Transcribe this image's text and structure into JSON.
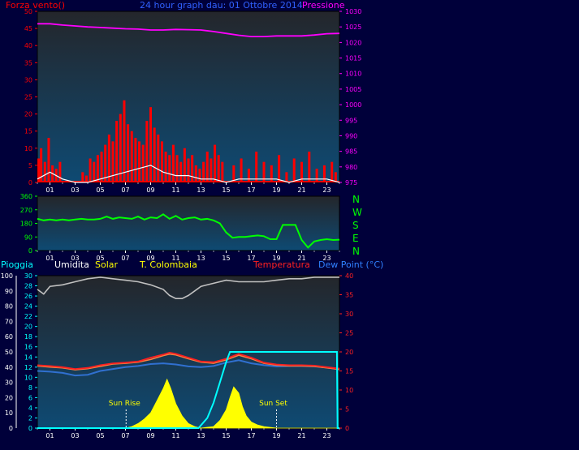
{
  "header": {
    "wind_label": "Forza vento()",
    "title": "24 hour graph dau: 01 Ottobre 2014",
    "pressure_label": "Pressione"
  },
  "bottom_header": {
    "rain_label": "Pioggia",
    "humidity_label": "Umidita",
    "solar_label": "Solar",
    "temp_colombaia_label": "T. Colombaia",
    "temperature_label": "Temperatura",
    "dewpoint_label": "Dew Point (°C)"
  },
  "direction_labels": [
    "N",
    "W",
    "S",
    "E",
    "N"
  ],
  "annotations": {
    "sunrise": "Sun Rise",
    "sunset": "Sun Set"
  },
  "colors": {
    "background": "#00003a",
    "wind": "#ff0000",
    "wind_avg": "#ffffff",
    "gust_green": "#00ff00",
    "pressure": "#ff00ff",
    "direction": "#00ff00",
    "humidity": "#c0c0c0",
    "solar": "#ffff00",
    "temperature": "#ff2020",
    "colombaia": "#ff8040",
    "dewpoint": "#3070d0",
    "rain": "#00ffff"
  },
  "chart_data": [
    {
      "type": "bar",
      "title": "24 hour graph dau: 01 Ottobre 2014",
      "x_ticks": [
        "01",
        "03",
        "05",
        "07",
        "09",
        "11",
        "13",
        "15",
        "17",
        "19",
        "21",
        "23"
      ],
      "xlim": [
        0,
        24
      ],
      "y_left": {
        "label": "Forza vento()",
        "ticks": [
          0,
          5,
          10,
          15,
          20,
          25,
          30,
          35,
          40,
          45,
          50
        ],
        "ylim": [
          0,
          50
        ]
      },
      "y_right": {
        "label": "Pressione",
        "ticks": [
          975,
          980,
          985,
          990,
          995,
          1000,
          1005,
          1010,
          1015,
          1020,
          1025,
          1030
        ],
        "ylim": [
          975,
          1030
        ]
      },
      "series": [
        {
          "name": "Forza vento()",
          "type": "bar",
          "x": [
            0.1,
            0.3,
            0.6,
            0.9,
            1.2,
            1.5,
            1.8,
            3.6,
            3.9,
            4.2,
            4.5,
            4.8,
            5.1,
            5.4,
            5.7,
            6.0,
            6.3,
            6.6,
            6.9,
            7.2,
            7.5,
            7.8,
            8.1,
            8.4,
            8.7,
            9.0,
            9.3,
            9.6,
            9.9,
            10.2,
            10.5,
            10.8,
            11.1,
            11.4,
            11.7,
            12.0,
            12.3,
            12.6,
            12.9,
            13.2,
            13.5,
            13.8,
            14.1,
            14.4,
            14.7,
            15.6,
            16.2,
            16.8,
            17.4,
            18.0,
            18.6,
            19.2,
            19.8,
            20.4,
            21.0,
            21.6,
            22.2,
            22.8,
            23.4,
            23.7
          ],
          "values": [
            7,
            10,
            6,
            13,
            5,
            4,
            6,
            3,
            2,
            7,
            6,
            8,
            9,
            11,
            14,
            12,
            18,
            20,
            24,
            17,
            15,
            13,
            12,
            11,
            18,
            22,
            16,
            14,
            12,
            9,
            8,
            11,
            8,
            6,
            10,
            7,
            8,
            5,
            4,
            6,
            9,
            7,
            11,
            8,
            6,
            5,
            7,
            4,
            9,
            6,
            5,
            8,
            3,
            7,
            6,
            9,
            4,
            5,
            6,
            3
          ]
        },
        {
          "name": "Media",
          "type": "line",
          "x": [
            0,
            1,
            2,
            3,
            4,
            5,
            6,
            7,
            8,
            9,
            10,
            11,
            12,
            13,
            14,
            15,
            16,
            17,
            18,
            19,
            20,
            21,
            22,
            23,
            24
          ],
          "values": [
            1,
            3,
            1,
            0,
            0,
            1,
            2,
            3,
            4,
            5,
            3,
            2,
            2,
            1,
            1,
            0,
            1,
            1,
            1,
            1,
            0,
            1,
            1,
            1,
            0
          ]
        },
        {
          "name": "Pressione",
          "type": "line",
          "x": [
            0,
            1,
            2,
            3,
            4,
            5,
            6,
            7,
            8,
            9,
            10,
            11,
            12,
            13,
            14,
            15,
            16,
            17,
            18,
            19,
            20,
            21,
            22,
            23,
            24
          ],
          "values": [
            1026,
            1026,
            1025.6,
            1025.3,
            1025,
            1024.8,
            1024.6,
            1024.4,
            1024.3,
            1024,
            1024,
            1024.2,
            1024.1,
            1024,
            1023.5,
            1022.9,
            1022.3,
            1021.9,
            1021.9,
            1022.1,
            1022.1,
            1022.1,
            1022.4,
            1022.8,
            1022.9
          ]
        }
      ]
    },
    {
      "type": "line",
      "x_ticks": [
        "01",
        "03",
        "05",
        "07",
        "09",
        "11",
        "13",
        "15",
        "17",
        "19",
        "21",
        "23"
      ],
      "xlim": [
        0,
        24
      ],
      "y_left": {
        "ticks": [
          0,
          90,
          180,
          270,
          360
        ],
        "ylim": [
          0,
          360
        ]
      },
      "series": [
        {
          "name": "Direzione",
          "x": [
            0,
            0.5,
            1,
            1.5,
            2,
            2.5,
            3,
            3.5,
            4,
            4.5,
            5,
            5.5,
            6,
            6.5,
            7,
            7.5,
            8,
            8.5,
            9,
            9.5,
            10,
            10.5,
            11,
            11.5,
            12,
            12.5,
            13,
            13.5,
            14,
            14.5,
            15,
            15.5,
            16,
            16.5,
            17,
            17.5,
            18,
            18.5,
            19,
            19.5,
            20,
            20.5,
            21,
            21.5,
            22,
            22.5,
            23,
            23.5,
            24
          ],
          "values": [
            210,
            200,
            205,
            200,
            205,
            200,
            205,
            210,
            205,
            205,
            210,
            225,
            210,
            220,
            215,
            210,
            225,
            205,
            220,
            215,
            240,
            210,
            230,
            205,
            215,
            220,
            205,
            210,
            200,
            180,
            120,
            85,
            90,
            90,
            95,
            100,
            95,
            75,
            75,
            170,
            170,
            170,
            70,
            20,
            60,
            70,
            75,
            70,
            72
          ]
        }
      ]
    },
    {
      "type": "line",
      "x_ticks": [
        "01",
        "03",
        "05",
        "07",
        "09",
        "11",
        "13",
        "15",
        "17",
        "19",
        "21",
        "23"
      ],
      "xlim": [
        0,
        24
      ],
      "y_left_humidity": {
        "label": "Umidita",
        "ticks": [
          0,
          10,
          20,
          30,
          40,
          50,
          60,
          70,
          80,
          90,
          100
        ],
        "ylim": [
          0,
          100
        ]
      },
      "y_left_rain": {
        "label": "Pioggia",
        "ticks": [
          0,
          2,
          4,
          6,
          8,
          10,
          12,
          14,
          16,
          18,
          20,
          22,
          24,
          26,
          28,
          30
        ],
        "ylim": [
          0,
          30
        ]
      },
      "y_right": {
        "label": "Dew Point (°C)",
        "ticks": [
          0,
          5,
          10,
          15,
          20,
          25,
          30,
          35,
          40
        ],
        "ylim": [
          0,
          40
        ]
      },
      "series": [
        {
          "name": "Umidita",
          "x": [
            0,
            0.5,
            1,
            2,
            3,
            4,
            5,
            6,
            7,
            8,
            9,
            10,
            10.5,
            11,
            11.5,
            12,
            12.5,
            13,
            14,
            15,
            16,
            17,
            18,
            19,
            20,
            21,
            22,
            23,
            24
          ],
          "values": [
            91,
            88,
            93,
            94,
            96,
            98,
            99,
            98,
            97,
            96,
            94,
            91,
            87,
            85,
            85,
            87,
            90,
            93,
            95,
            97,
            96,
            96,
            96,
            97,
            98,
            98,
            99,
            99,
            99
          ]
        },
        {
          "name": "Solar",
          "x": [
            0,
            7,
            7.5,
            8,
            8.5,
            9,
            9.5,
            10,
            10.3,
            10.6,
            11,
            11.5,
            12,
            12.5,
            13,
            14,
            14.5,
            15,
            15.3,
            15.6,
            16,
            16.3,
            16.6,
            17,
            17.5,
            18,
            19,
            24
          ],
          "values": [
            0,
            0,
            1,
            3,
            6,
            10,
            18,
            26,
            32,
            26,
            16,
            8,
            3,
            1,
            0,
            1,
            5,
            12,
            20,
            27,
            23,
            14,
            8,
            4,
            2,
            1,
            0,
            0
          ]
        },
        {
          "name": "Temperatura",
          "x": [
            0,
            1,
            2,
            3,
            4,
            5,
            6,
            7,
            8,
            9,
            10,
            10.5,
            11,
            12,
            13,
            14,
            15,
            16,
            17,
            18,
            19,
            20,
            21,
            22,
            23,
            24
          ],
          "values": [
            16.5,
            16.3,
            16,
            15.5,
            15.8,
            16.5,
            17,
            17.2,
            17.5,
            18.5,
            19.3,
            19.8,
            19.5,
            18.5,
            17.5,
            17.3,
            18.2,
            19.5,
            18.5,
            17.2,
            16.7,
            16.5,
            16.5,
            16.4,
            16,
            15.6
          ]
        },
        {
          "name": "T. Colombaia",
          "x": [
            0,
            1,
            2,
            3,
            4,
            5,
            6,
            7,
            8,
            9,
            10,
            10.5,
            11,
            12,
            13,
            14,
            15,
            16,
            17,
            18,
            19,
            20,
            21,
            22,
            23,
            24
          ],
          "values": [
            16.3,
            16,
            15.8,
            15.3,
            15.6,
            16.2,
            16.8,
            17,
            17.3,
            18,
            19,
            19.4,
            19.2,
            18.2,
            17.3,
            17,
            17.9,
            19.1,
            18.2,
            17,
            16.5,
            16.3,
            16.3,
            16.2,
            15.8,
            15.4
          ]
        },
        {
          "name": "Dew Point (°C)",
          "x": [
            0,
            1,
            2,
            3,
            4,
            5,
            6,
            7,
            8,
            9,
            10,
            11,
            12,
            13,
            14,
            15,
            16,
            17,
            18,
            19,
            20,
            21,
            22,
            23,
            24
          ],
          "values": [
            15,
            14.8,
            14.5,
            13.8,
            14,
            15,
            15.5,
            16,
            16.3,
            16.8,
            17,
            16.7,
            16.2,
            16,
            16.3,
            17.2,
            17.8,
            17,
            16.5,
            16.2,
            16.3,
            16.3,
            16.2,
            15.9,
            15.4
          ]
        },
        {
          "name": "Pioggia",
          "x": [
            0,
            12.8,
            13.5,
            14,
            14.5,
            15,
            15.3,
            16,
            18,
            20,
            22,
            23.8,
            23.85,
            24
          ],
          "values": [
            0,
            0,
            2,
            5,
            9,
            13,
            15,
            15,
            15,
            15,
            15,
            15,
            0,
            0
          ]
        }
      ],
      "annotations": [
        {
          "text": "Sun Rise",
          "x": 7.05
        },
        {
          "text": "Sun Set",
          "x": 19.0
        }
      ]
    }
  ]
}
